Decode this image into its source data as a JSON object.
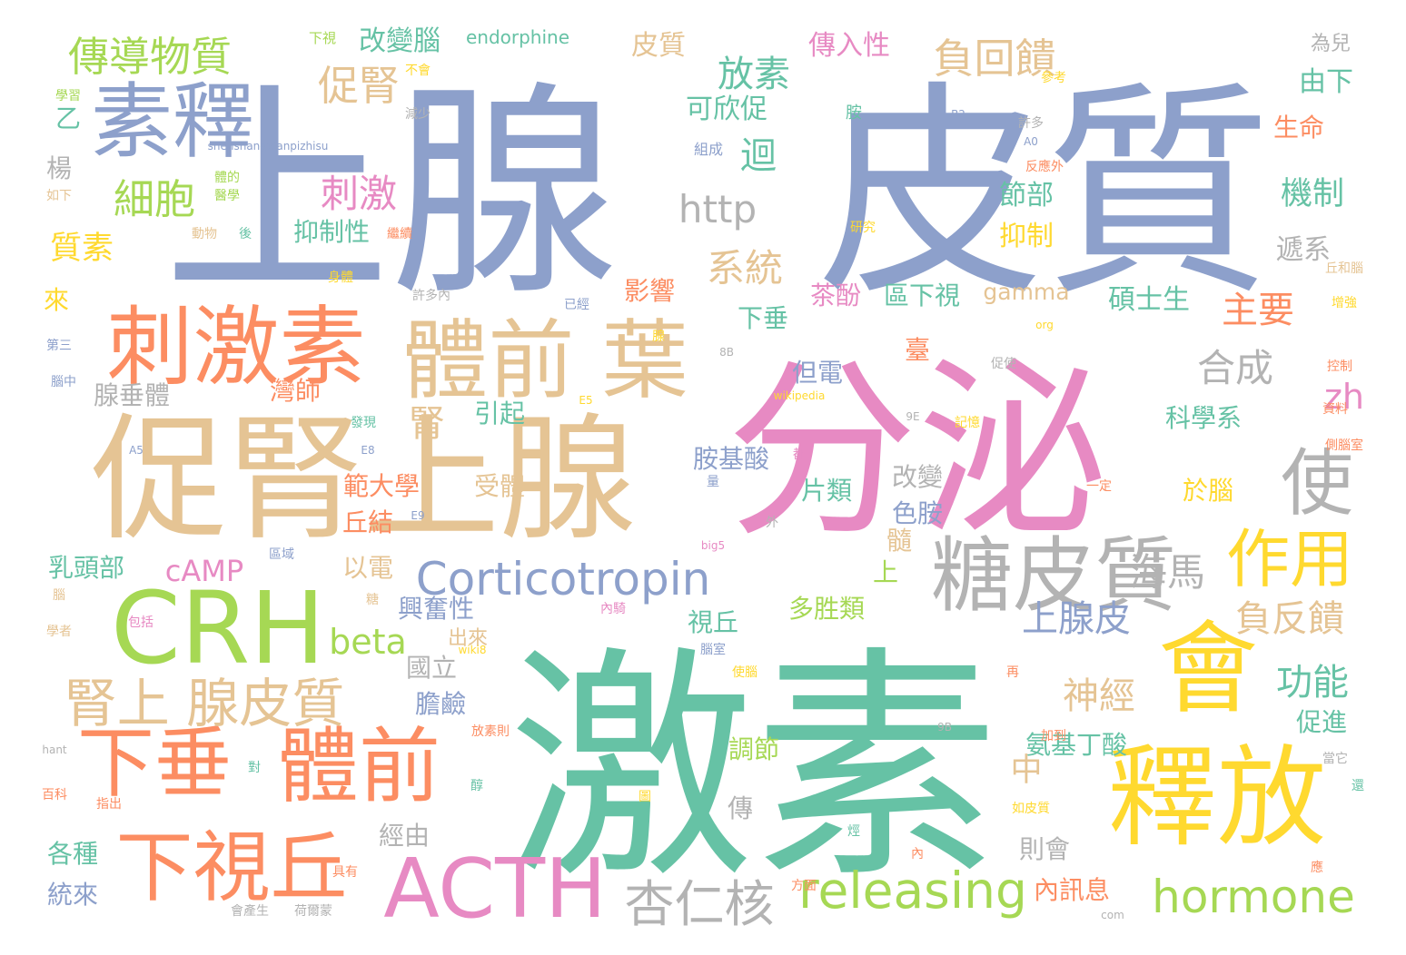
{
  "palette": {
    "blue": "#8DA0CB",
    "pink": "#E78AC3",
    "green": "#66C2A5",
    "lime": "#A6D854",
    "yellow": "#FFD92F",
    "tan": "#E5C494",
    "orange": "#FC8D62",
    "gray": "#B3B3B3"
  },
  "words": [
    {
      "text": "上腺",
      "color": "blue"
    },
    {
      "text": "皮質",
      "color": "blue"
    },
    {
      "text": "激素",
      "color": "green"
    },
    {
      "text": "分泌",
      "color": "pink"
    },
    {
      "text": "促腎上腺",
      "color": "tan"
    },
    {
      "text": "素釋",
      "color": "blue"
    },
    {
      "text": "刺激素",
      "color": "orange"
    },
    {
      "text": "體前 葉",
      "color": "tan"
    },
    {
      "text": "CRH",
      "color": "lime"
    },
    {
      "text": "釋放",
      "color": "yellow"
    },
    {
      "text": "會",
      "color": "yellow"
    },
    {
      "text": "糖皮質",
      "color": "gray"
    },
    {
      "text": "ACTH",
      "color": "pink"
    },
    {
      "text": "下垂",
      "color": "orange"
    },
    {
      "text": "體前",
      "color": "orange"
    },
    {
      "text": "下視丘",
      "color": "orange"
    },
    {
      "text": "腎上 腺皮質",
      "color": "tan"
    },
    {
      "text": "Corticotropin",
      "color": "blue"
    },
    {
      "text": "作用",
      "color": "yellow"
    },
    {
      "text": "使",
      "color": "gray"
    },
    {
      "text": "releasing",
      "color": "lime"
    },
    {
      "text": "hormone",
      "color": "lime"
    },
    {
      "text": "杏仁核",
      "color": "gray"
    },
    {
      "text": "傳導物質",
      "color": "lime"
    },
    {
      "text": "促腎",
      "color": "tan"
    },
    {
      "text": "細胞",
      "color": "lime"
    },
    {
      "text": "刺激",
      "color": "pink"
    },
    {
      "text": "負回饋",
      "color": "tan"
    },
    {
      "text": "放素",
      "color": "green"
    },
    {
      "text": "迴",
      "color": "green"
    },
    {
      "text": "http",
      "color": "gray"
    },
    {
      "text": "系統",
      "color": "tan"
    },
    {
      "text": "合成",
      "color": "gray"
    },
    {
      "text": "海馬",
      "color": "gray"
    },
    {
      "text": "主要",
      "color": "orange"
    },
    {
      "text": "功能",
      "color": "green"
    },
    {
      "text": "神經",
      "color": "tan"
    },
    {
      "text": "上腺皮",
      "color": "blue"
    },
    {
      "text": "負反饋",
      "color": "tan"
    },
    {
      "text": "beta",
      "color": "lime"
    },
    {
      "text": "機制",
      "color": "green"
    },
    {
      "text": "腎",
      "color": "tan"
    },
    {
      "text": "zh",
      "color": "pink"
    },
    {
      "text": "中",
      "color": "tan"
    },
    {
      "text": "質素",
      "color": "yellow"
    },
    {
      "text": "cAMP",
      "color": "pink"
    },
    {
      "text": "皮質",
      "color": "tan"
    },
    {
      "text": "可欣促",
      "color": "green"
    },
    {
      "text": "改變腦",
      "color": "green"
    },
    {
      "text": "endorphine",
      "color": "green"
    },
    {
      "text": "傳入性",
      "color": "pink"
    },
    {
      "text": "由下",
      "color": "green"
    },
    {
      "text": "生命",
      "color": "orange"
    },
    {
      "text": "為兒",
      "color": "gray"
    },
    {
      "text": "節部",
      "color": "green"
    },
    {
      "text": "抑制",
      "color": "yellow"
    },
    {
      "text": "碩士生",
      "color": "green"
    },
    {
      "text": "科學系",
      "color": "green"
    },
    {
      "text": "遞系",
      "color": "gray"
    },
    {
      "text": "腺垂體",
      "color": "gray"
    },
    {
      "text": "灣師",
      "color": "orange"
    },
    {
      "text": "引起",
      "color": "green"
    },
    {
      "text": "範大學",
      "color": "orange"
    },
    {
      "text": "受體",
      "color": "tan"
    },
    {
      "text": "丘結",
      "color": "orange"
    },
    {
      "text": "以電",
      "color": "tan"
    },
    {
      "text": "改變",
      "color": "gray"
    },
    {
      "text": "色胺",
      "color": "blue"
    },
    {
      "text": "於腦",
      "color": "yellow"
    },
    {
      "text": "乳頭部",
      "color": "green"
    },
    {
      "text": "影響",
      "color": "orange"
    },
    {
      "text": "茶酚",
      "color": "pink"
    },
    {
      "text": "區下視",
      "color": "green"
    },
    {
      "text": "gamma",
      "color": "tan"
    },
    {
      "text": "下垂",
      "color": "green"
    },
    {
      "text": "臺",
      "color": "orange"
    },
    {
      "text": "但電",
      "color": "blue"
    },
    {
      "text": "楊",
      "color": "gray"
    },
    {
      "text": "乙",
      "color": "green"
    },
    {
      "text": "來",
      "color": "yellow"
    },
    {
      "text": "國立",
      "color": "gray"
    },
    {
      "text": "興奮性",
      "color": "blue"
    },
    {
      "text": "出來",
      "color": "tan"
    },
    {
      "text": "視丘",
      "color": "green"
    },
    {
      "text": "膽鹼",
      "color": "blue"
    },
    {
      "text": "上",
      "color": "lime"
    },
    {
      "text": "髓",
      "color": "tan"
    },
    {
      "text": "片類",
      "color": "green"
    },
    {
      "text": "胺基酸",
      "color": "blue"
    },
    {
      "text": "多胜類",
      "color": "lime"
    },
    {
      "text": "氨基丁酸",
      "color": "green"
    },
    {
      "text": "促進",
      "color": "green"
    },
    {
      "text": "調節",
      "color": "lime"
    },
    {
      "text": "傳",
      "color": "gray"
    },
    {
      "text": "經由",
      "color": "gray"
    },
    {
      "text": "則會",
      "color": "gray"
    },
    {
      "text": "內訊息",
      "color": "orange"
    },
    {
      "text": "各種",
      "color": "green"
    },
    {
      "text": "統來",
      "color": "blue"
    },
    {
      "text": "抑制性",
      "color": "green"
    },
    {
      "text": "下視",
      "color": "lime"
    },
    {
      "text": "不會",
      "color": "yellow"
    },
    {
      "text": "學習",
      "color": "lime"
    },
    {
      "text": "減少",
      "color": "gray"
    },
    {
      "text": "shenshangxianpizhisu",
      "color": "blue"
    },
    {
      "text": "體的",
      "color": "lime"
    },
    {
      "text": "醫學",
      "color": "lime"
    },
    {
      "text": "如下",
      "color": "tan"
    },
    {
      "text": "動物",
      "color": "tan"
    },
    {
      "text": "後",
      "color": "green"
    },
    {
      "text": "繼續",
      "color": "orange"
    },
    {
      "text": "身體",
      "color": "yellow"
    },
    {
      "text": "許多內",
      "color": "gray"
    },
    {
      "text": "已經",
      "color": "blue"
    },
    {
      "text": "第三",
      "color": "blue"
    },
    {
      "text": "腦中",
      "color": "blue"
    },
    {
      "text": "腺",
      "color": "yellow"
    },
    {
      "text": "組成",
      "color": "blue"
    },
    {
      "text": "胺",
      "color": "green"
    },
    {
      "text": "B2",
      "color": "blue"
    },
    {
      "text": "許多",
      "color": "gray"
    },
    {
      "text": "A0",
      "color": "blue"
    },
    {
      "text": "反應外",
      "color": "orange"
    },
    {
      "text": "參考",
      "color": "yellow"
    },
    {
      "text": "研究",
      "color": "yellow"
    },
    {
      "text": "丘和腦",
      "color": "tan"
    },
    {
      "text": "增強",
      "color": "yellow"
    },
    {
      "text": "控制",
      "color": "orange"
    },
    {
      "text": "資料",
      "color": "orange"
    },
    {
      "text": "側腦室",
      "color": "orange"
    },
    {
      "text": "org",
      "color": "yellow"
    },
    {
      "text": "8B",
      "color": "gray"
    },
    {
      "text": "促使",
      "color": "gray"
    },
    {
      "text": "wikipedia",
      "color": "yellow"
    },
    {
      "text": "記憶",
      "color": "yellow"
    },
    {
      "text": "9E",
      "color": "gray"
    },
    {
      "text": "一定",
      "color": "orange"
    },
    {
      "text": "E5",
      "color": "yellow"
    },
    {
      "text": "A5",
      "color": "blue"
    },
    {
      "text": "發現",
      "color": "green"
    },
    {
      "text": "E8",
      "color": "blue"
    },
    {
      "text": "E9",
      "color": "blue"
    },
    {
      "text": "都",
      "color": "pink"
    },
    {
      "text": "量",
      "color": "blue"
    },
    {
      "text": "外",
      "color": "gray"
    },
    {
      "text": "big5",
      "color": "pink"
    },
    {
      "text": "區域",
      "color": "blue"
    },
    {
      "text": "內騎",
      "color": "pink"
    },
    {
      "text": "腦室",
      "color": "blue"
    },
    {
      "text": "wiki8",
      "color": "yellow"
    },
    {
      "text": "使腦",
      "color": "yellow"
    },
    {
      "text": "包括",
      "color": "pink"
    },
    {
      "text": "學者",
      "color": "tan"
    },
    {
      "text": "腦",
      "color": "tan"
    },
    {
      "text": "糖",
      "color": "tan"
    },
    {
      "text": "再",
      "color": "orange"
    },
    {
      "text": "9B",
      "color": "gray"
    },
    {
      "text": "加到",
      "color": "orange"
    },
    {
      "text": "當它",
      "color": "gray"
    },
    {
      "text": "還",
      "color": "green"
    },
    {
      "text": "放素則",
      "color": "orange"
    },
    {
      "text": "hant",
      "color": "gray"
    },
    {
      "text": "對",
      "color": "green"
    },
    {
      "text": "醇",
      "color": "green"
    },
    {
      "text": "百科",
      "color": "orange"
    },
    {
      "text": "指出",
      "color": "orange"
    },
    {
      "text": "圖",
      "color": "yellow"
    },
    {
      "text": "如皮質",
      "color": "yellow"
    },
    {
      "text": "烴",
      "color": "green"
    },
    {
      "text": "內",
      "color": "orange"
    },
    {
      "text": "具有",
      "color": "orange"
    },
    {
      "text": "方面",
      "color": "orange"
    },
    {
      "text": "應",
      "color": "orange"
    },
    {
      "text": "會產生",
      "color": "gray"
    },
    {
      "text": "荷爾蒙",
      "color": "gray"
    },
    {
      "text": "com",
      "color": "gray"
    }
  ]
}
